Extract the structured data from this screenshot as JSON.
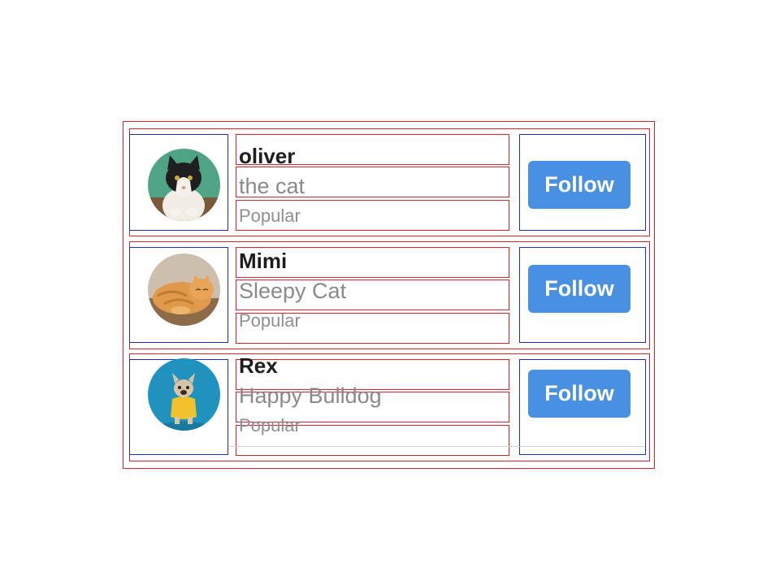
{
  "accent_color": "#4a90e2",
  "users": [
    {
      "name": "oliver",
      "subtitle": "the cat",
      "tag": "Popular",
      "button_label": "Follow",
      "avatar_icon": "tuxedo-cat-photo"
    },
    {
      "name": "Mimi",
      "subtitle": "Sleepy Cat",
      "tag": "Popular",
      "button_label": "Follow",
      "avatar_icon": "orange-tabby-cat-photo"
    },
    {
      "name": "Rex",
      "subtitle": "Happy Bulldog",
      "tag": "Popular",
      "button_label": "Follow",
      "avatar_icon": "french-bulldog-photo"
    }
  ]
}
